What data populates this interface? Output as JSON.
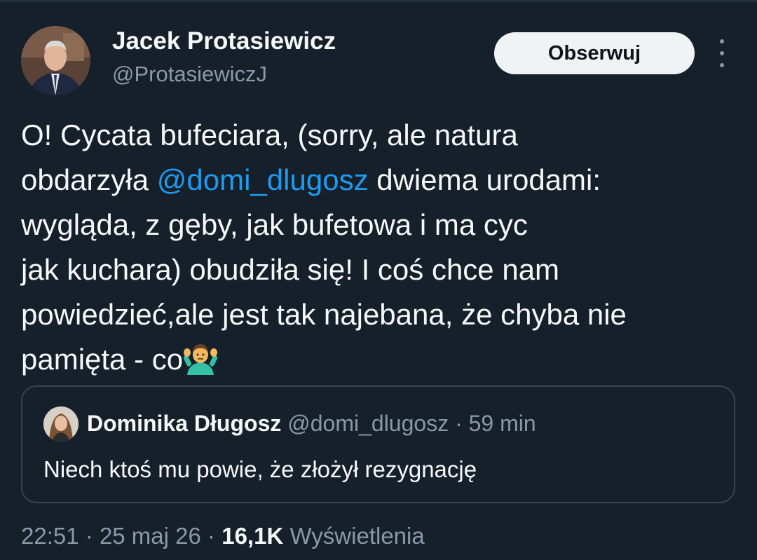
{
  "author": {
    "name": "Jacek Protasiewicz",
    "handle": "@ProtasiewiczJ",
    "avatar_icon": "profile-photo-man-in-suit"
  },
  "follow_button": {
    "label": "Obserwuj"
  },
  "more_button": {
    "icon": "vertical-ellipsis-icon"
  },
  "tweet": {
    "lines": [
      {
        "text": "O! Cycata bufeciara, (sorry, ale natura"
      },
      {
        "before": "obdarzyła ",
        "mention": "@domi_dlugosz",
        "after": " dwiema urodami:"
      },
      {
        "text": "wygląda, z gęby, jak bufetowa i ma cyc"
      },
      {
        "text": "jak  kuchara) obudziła się! I coś chce nam"
      },
      {
        "text": "powiedzieć,ale jest tak najebana, że chyba nie"
      },
      {
        "text": "pamięta - co",
        "emoji": "person-shrugging-emoji"
      }
    ]
  },
  "quote": {
    "name": "Dominika Długosz",
    "handle": "@domi_dlugosz",
    "separator": "·",
    "time": "59 min",
    "text": "Niech ktoś mu powie, że złożył rezygnację",
    "avatar_icon": "profile-photo-woman"
  },
  "meta": {
    "time": "22:51",
    "separator": "·",
    "date": "25 maj 26",
    "views_count": "16,1K",
    "views_label": "Wyświetlenia"
  },
  "colors": {
    "background": "#15202b",
    "text": "#f7f9f9",
    "secondary_text": "#8b98a5",
    "accent": "#1d9bf0",
    "border": "#38444d",
    "button_bg": "#eff3f4"
  }
}
